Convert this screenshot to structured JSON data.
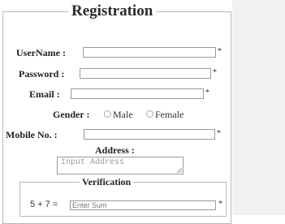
{
  "form": {
    "legend": "Registration",
    "username_label": "UserName :",
    "password_label": "Password :",
    "email_label": "Email :",
    "gender_label": "Gender :",
    "gender_options": [
      "Male",
      "Female"
    ],
    "mobile_label": "Mobile No. :",
    "address_label": "Address :",
    "address_placeholder": "Input Address",
    "required_mark": "*"
  },
  "verification": {
    "legend": "Verification",
    "equation": "5 + 7 =",
    "placeholder": "Enter Sum",
    "required_mark": "*"
  }
}
